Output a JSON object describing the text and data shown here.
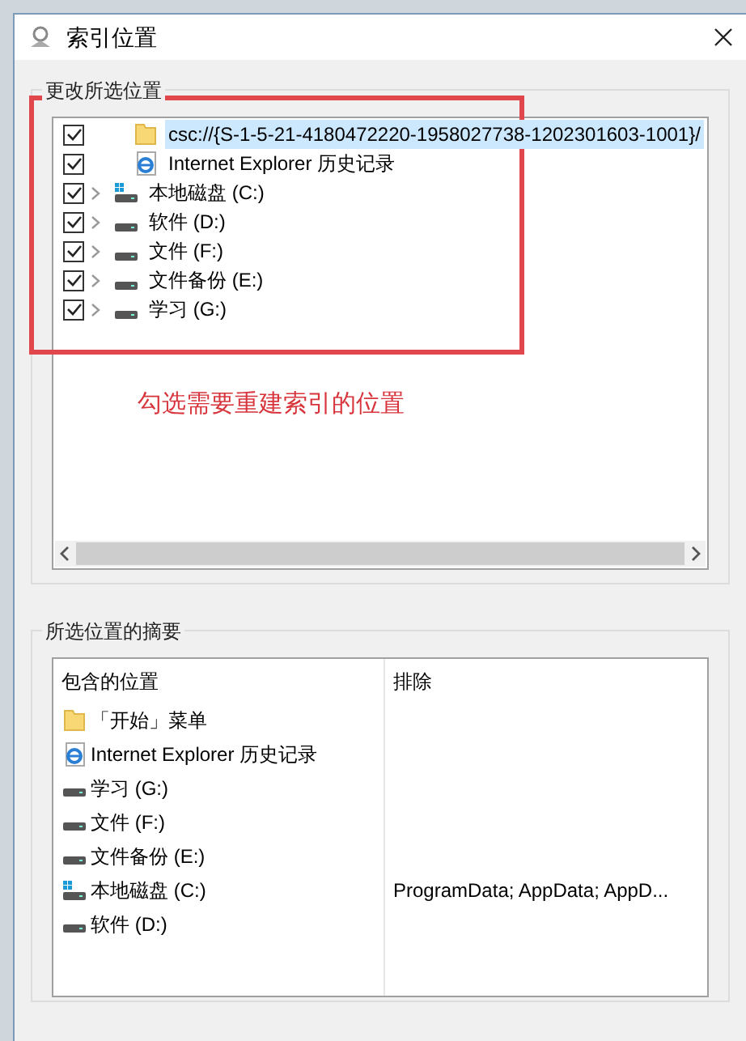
{
  "window": {
    "title": "索引位置"
  },
  "change_group": {
    "label": "更改所选位置",
    "tree": [
      {
        "kind": "folder",
        "label": "csc://{S-1-5-21-4180472220-1958027738-1202301603-1001}/",
        "checked": true,
        "selected": true,
        "expandable": false
      },
      {
        "kind": "ie",
        "label": "Internet Explorer 历史记录",
        "checked": true,
        "selected": false,
        "expandable": false
      },
      {
        "kind": "system-drive",
        "label": "本地磁盘 (C:)",
        "checked": true,
        "selected": false,
        "expandable": true
      },
      {
        "kind": "drive",
        "label": "软件 (D:)",
        "checked": true,
        "selected": false,
        "expandable": true
      },
      {
        "kind": "drive",
        "label": "文件 (F:)",
        "checked": true,
        "selected": false,
        "expandable": true
      },
      {
        "kind": "drive",
        "label": "文件备份 (E:)",
        "checked": true,
        "selected": false,
        "expandable": true
      },
      {
        "kind": "drive",
        "label": "学习 (G:)",
        "checked": true,
        "selected": false,
        "expandable": true
      }
    ]
  },
  "annotation": "勾选需要重建索引的位置",
  "summary_group": {
    "label": "所选位置的摘要",
    "columns": [
      "包含的位置",
      "排除"
    ],
    "rows": [
      {
        "kind": "folder",
        "included": "「开始」菜单"
      },
      {
        "kind": "ie",
        "included": "Internet Explorer 历史记录"
      },
      {
        "kind": "drive",
        "included": "学习 (G:)"
      },
      {
        "kind": "drive",
        "included": "文件 (F:)"
      },
      {
        "kind": "drive",
        "included": "文件备份 (E:)"
      },
      {
        "kind": "system-drive",
        "included": "本地磁盘 (C:)",
        "excluded": "ProgramData; AppData; AppD..."
      },
      {
        "kind": "drive",
        "included": "软件 (D:)"
      }
    ]
  }
}
